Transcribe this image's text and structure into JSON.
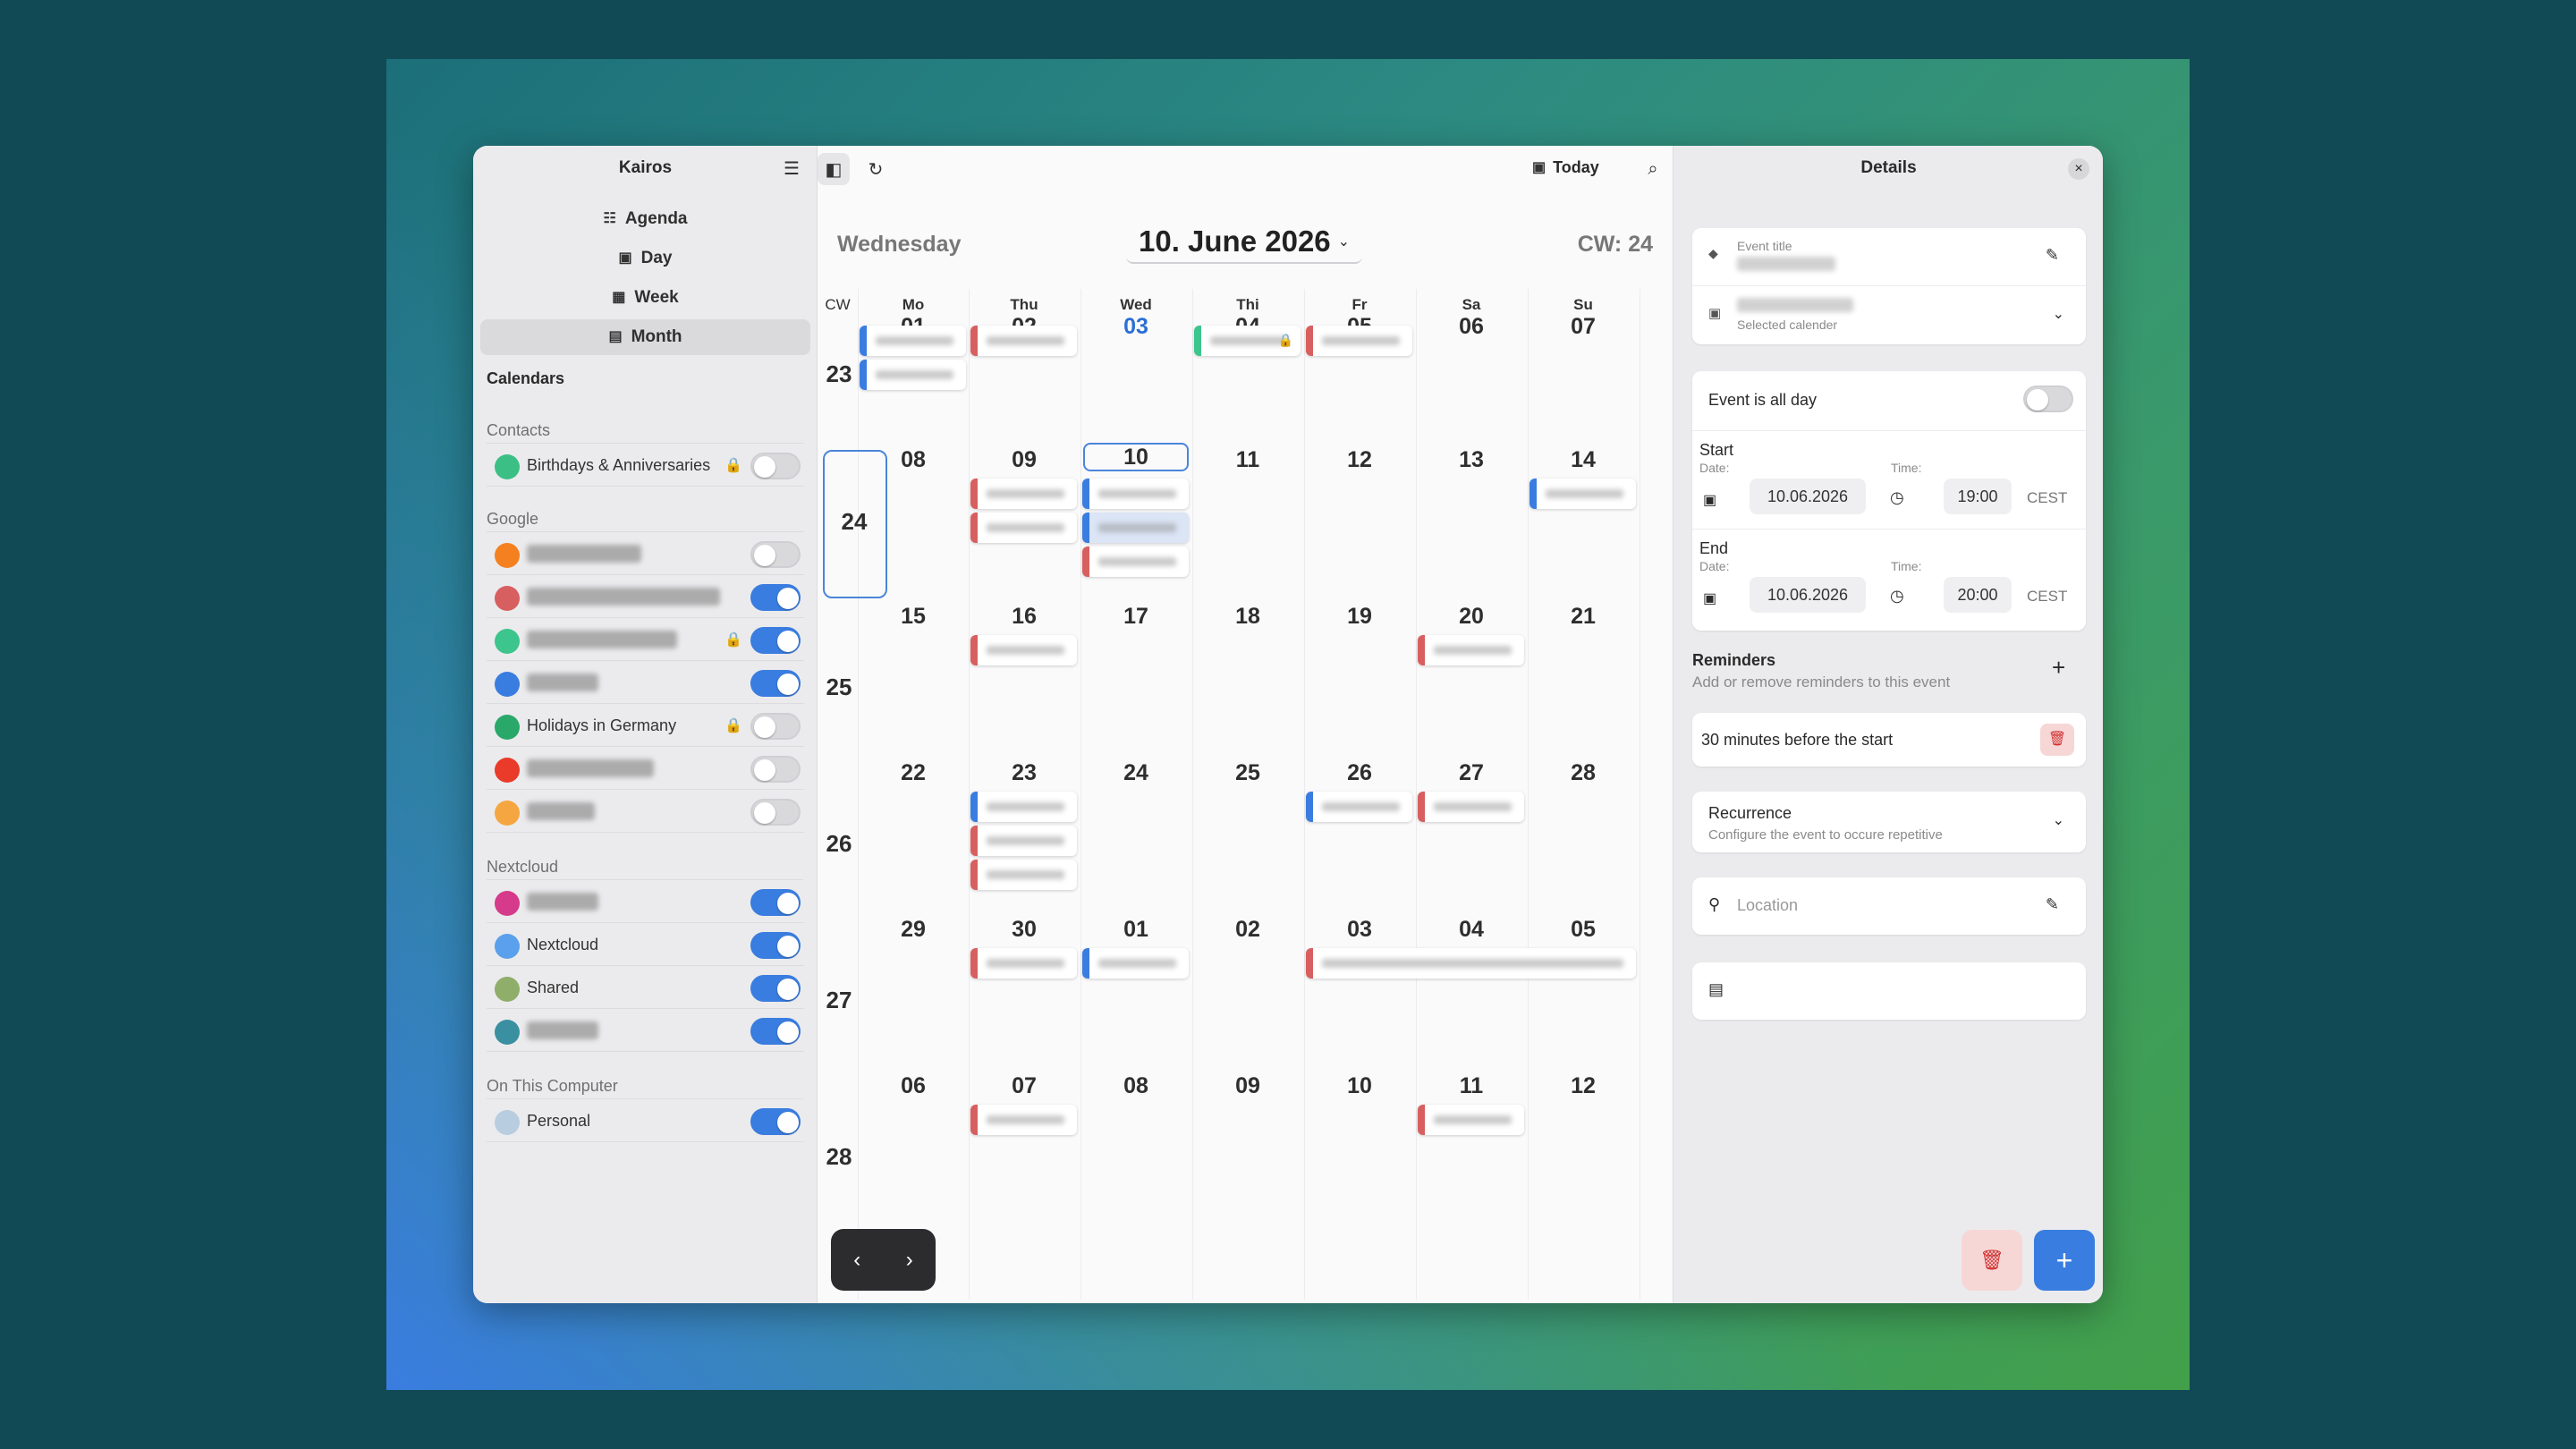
{
  "sidebar": {
    "app_title": "Kairos",
    "views": [
      "Agenda",
      "Day",
      "Week",
      "Month"
    ],
    "calendars_heading": "Calendars",
    "groups": [
      {
        "label": "Contacts",
        "items": [
          {
            "name": "Birthdays & Anniversaries",
            "color": "#3cbf85",
            "locked": true,
            "on": false
          }
        ]
      },
      {
        "label": "Google",
        "items": [
          {
            "name": "",
            "color": "#f5801f",
            "on": false
          },
          {
            "name": "",
            "color": "#d85f5f",
            "on": true
          },
          {
            "name": "",
            "color": "#3cc58c",
            "locked": true,
            "on": true
          },
          {
            "name": "",
            "color": "#3a7de0",
            "on": true
          },
          {
            "name": "Holidays in Germany",
            "color": "#2aa86a",
            "locked": true,
            "on": false
          },
          {
            "name": "",
            "color": "#ea3a2a",
            "on": false
          },
          {
            "name": "",
            "color": "#f6a640",
            "on": false
          }
        ]
      },
      {
        "label": "Nextcloud",
        "items": [
          {
            "name": "",
            "color": "#d63a8a",
            "on": true
          },
          {
            "name": "Nextcloud",
            "color": "#5aa0ec",
            "on": true
          },
          {
            "name": "Shared",
            "color": "#8fae6a",
            "on": true
          },
          {
            "name": "",
            "color": "#3a90a0",
            "on": true
          }
        ]
      },
      {
        "label": "On This Computer",
        "items": [
          {
            "name": "Personal",
            "color": "#b8cde0",
            "on": true
          }
        ]
      }
    ]
  },
  "header": {
    "today_label": "Today",
    "weekday": "Wednesday",
    "date_title": "10. June 2026",
    "cw_label": "CW: 24"
  },
  "month": {
    "cw_header": "CW",
    "day_headers": [
      {
        "name": "Mo",
        "num": "01"
      },
      {
        "name": "Thu",
        "num": "02"
      },
      {
        "name": "Wed",
        "num": "03"
      },
      {
        "name": "Thi",
        "num": "04"
      },
      {
        "name": "Fr",
        "num": "05"
      },
      {
        "name": "Sa",
        "num": "06"
      },
      {
        "name": "Su",
        "num": "07"
      }
    ],
    "weeks": [
      {
        "cw": "23",
        "days": [
          "",
          "",
          "",
          "",
          "",
          "",
          ""
        ]
      },
      {
        "cw": "24",
        "days": [
          "08",
          "09",
          "10",
          "11",
          "12",
          "13",
          "14"
        ]
      },
      {
        "cw": "25",
        "days": [
          "15",
          "16",
          "17",
          "18",
          "19",
          "20",
          "21"
        ]
      },
      {
        "cw": "26",
        "days": [
          "22",
          "23",
          "24",
          "25",
          "26",
          "27",
          "28"
        ]
      },
      {
        "cw": "27",
        "days": [
          "29",
          "30",
          "01",
          "02",
          "03",
          "04",
          "05"
        ]
      },
      {
        "cw": "28",
        "days": [
          "06",
          "07",
          "08",
          "09",
          "10",
          "11",
          "12"
        ]
      }
    ]
  },
  "details": {
    "title": "Details",
    "event_title_label": "Event title",
    "selected_calendar_label": "Selected calender",
    "all_day_label": "Event is all day",
    "start_label": "Start",
    "end_label": "End",
    "date_label": "Date:",
    "time_label": "Time:",
    "start_date": "10.06.2026",
    "start_time": "19:00",
    "end_date": "10.06.2026",
    "end_time": "20:00",
    "timezone": "CEST",
    "reminders_title": "Reminders",
    "reminders_sub": "Add or remove reminders to this event",
    "reminder_item": "30 minutes before the start",
    "recurrence_title": "Recurrence",
    "recurrence_sub": "Configure the event to occure repetitive",
    "location_placeholder": "Location"
  }
}
